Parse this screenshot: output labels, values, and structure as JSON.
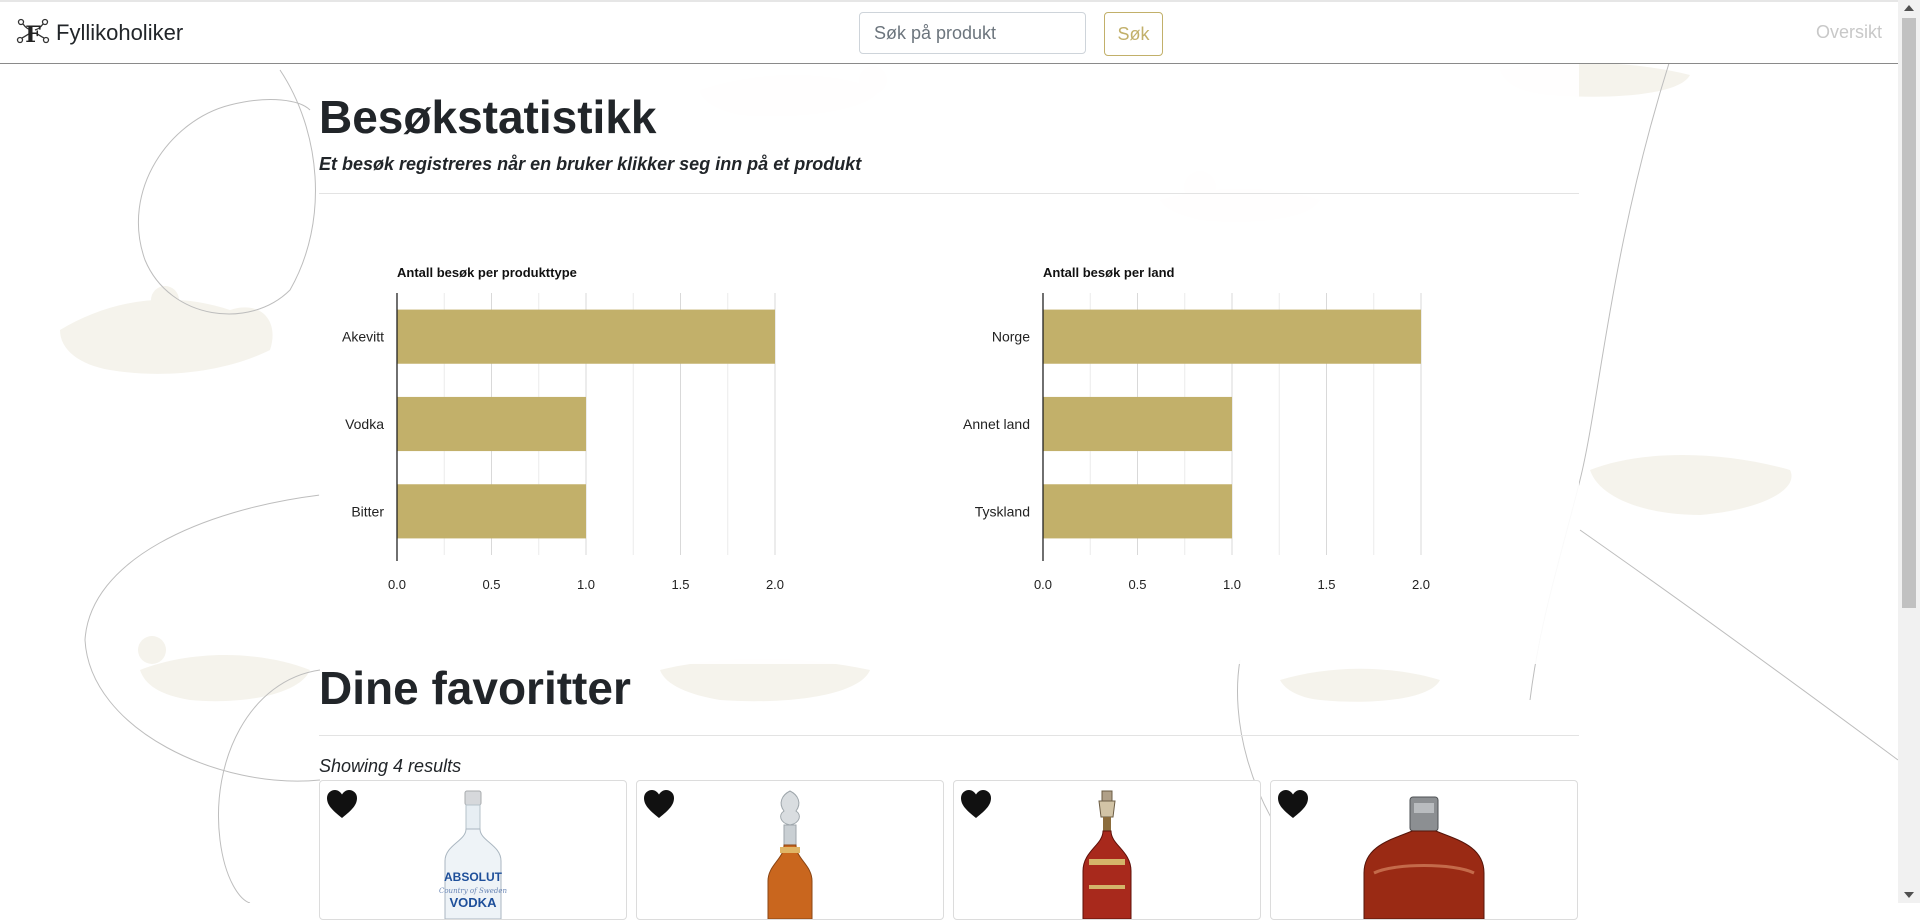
{
  "navbar": {
    "brand": "Fyllikoholiker",
    "search_placeholder": "Søk på produkt",
    "search_button": "Søk",
    "nav_link": "Oversikt"
  },
  "stats": {
    "title": "Besøkstatistikk",
    "subtitle": "Et besøk registreres når en bruker klikker seg inn på et produkt"
  },
  "chart_data": [
    {
      "type": "bar",
      "orientation": "horizontal",
      "title": "Antall besøk per produkttype",
      "categories": [
        "Akevitt",
        "Vodka",
        "Bitter"
      ],
      "values": [
        2,
        1,
        1
      ],
      "xlim": [
        0,
        2
      ],
      "ticks": [
        "0.0",
        "0.5",
        "1.0",
        "1.5",
        "2.0"
      ],
      "grid": true,
      "color": "#c2b06a"
    },
    {
      "type": "bar",
      "orientation": "horizontal",
      "title": "Antall besøk per land",
      "categories": [
        "Norge",
        "Annet land",
        "Tyskland"
      ],
      "values": [
        2,
        1,
        1
      ],
      "xlim": [
        0,
        2
      ],
      "ticks": [
        "0.0",
        "0.5",
        "1.0",
        "1.5",
        "2.0"
      ],
      "grid": true,
      "color": "#c2b06a"
    }
  ],
  "favorites": {
    "title": "Dine favoritter",
    "results_text": "Showing 4 results",
    "items": [
      {
        "icon": "heart-icon",
        "image": "vodka-bottle"
      },
      {
        "icon": "heart-icon",
        "image": "decanter-bottle"
      },
      {
        "icon": "heart-icon",
        "image": "ornate-decanter-bottle"
      },
      {
        "icon": "heart-icon",
        "image": "cognac-bottle"
      }
    ]
  },
  "colors": {
    "accent": "#c2b06a",
    "text": "#212529",
    "nav_link": "#c8c8c8"
  }
}
